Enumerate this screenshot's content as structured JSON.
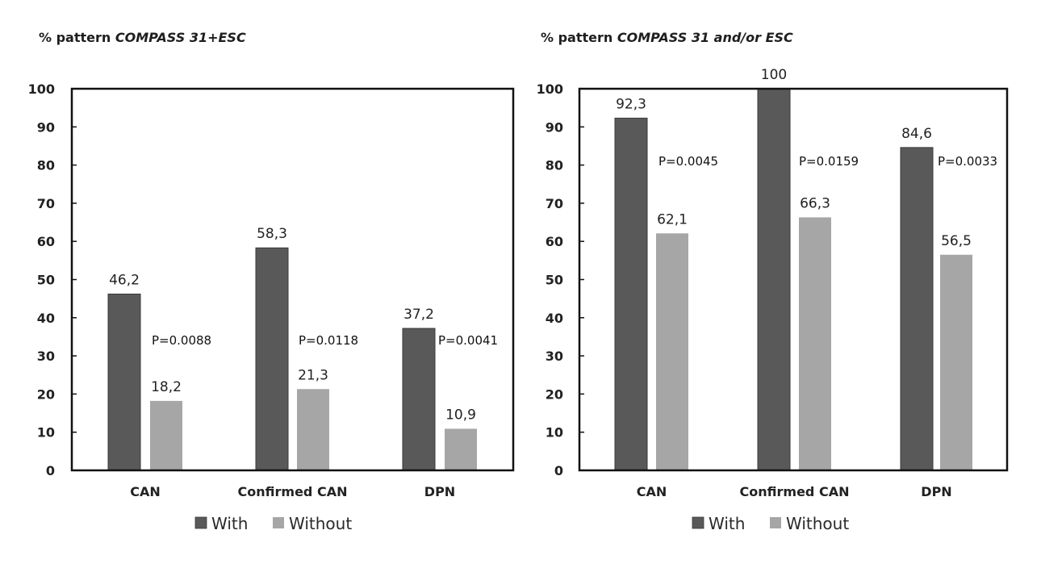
{
  "colors": {
    "with": "#595959",
    "without": "#a6a6a6",
    "axis": "#111111"
  },
  "chart_data": [
    {
      "type": "bar",
      "title_prefix": "% pattern ",
      "title_italic": "COMPASS 31+ESC",
      "categories": [
        "CAN",
        "Confirmed CAN",
        "DPN"
      ],
      "series": [
        {
          "name": "With",
          "values": [
            46.2,
            58.3,
            37.2
          ],
          "labels": [
            "46,2",
            "58,3",
            "37,2"
          ]
        },
        {
          "name": "Without",
          "values": [
            18.2,
            21.3,
            10.9
          ],
          "labels": [
            "18,2",
            "21,3",
            "10,9"
          ]
        }
      ],
      "annotations": [
        "P=0.0088",
        "P=0.0118",
        "P=0.0041"
      ],
      "annotation_y": [
        34,
        34,
        34
      ],
      "yticks": [
        "0",
        "10",
        "20",
        "30",
        "40",
        "50",
        "60",
        "70",
        "80",
        "90",
        "100"
      ],
      "ylim": [
        0,
        100
      ],
      "xlabel": "",
      "ylabel": "",
      "grid": false,
      "legend": [
        "With",
        "Without"
      ],
      "legend_position": "bottom"
    },
    {
      "type": "bar",
      "title_prefix": "% pattern ",
      "title_italic": "COMPASS 31 and/or ESC",
      "categories": [
        "CAN",
        "Confirmed CAN",
        "DPN"
      ],
      "series": [
        {
          "name": "With",
          "values": [
            92.3,
            100,
            84.6
          ],
          "labels": [
            "92,3",
            "100",
            "84,6"
          ]
        },
        {
          "name": "Without",
          "values": [
            62.1,
            66.3,
            56.5
          ],
          "labels": [
            "62,1",
            "66,3",
            "56,5"
          ]
        }
      ],
      "annotations": [
        "P=0.0045",
        "P=0.0159",
        "P=0.0033"
      ],
      "annotation_y": [
        81,
        81,
        81
      ],
      "yticks": [
        "0",
        "10",
        "20",
        "30",
        "40",
        "50",
        "60",
        "70",
        "80",
        "90",
        "100"
      ],
      "ylim": [
        0,
        100
      ],
      "xlabel": "",
      "ylabel": "",
      "grid": false,
      "legend": [
        "With",
        "Without"
      ],
      "legend_position": "bottom"
    }
  ]
}
